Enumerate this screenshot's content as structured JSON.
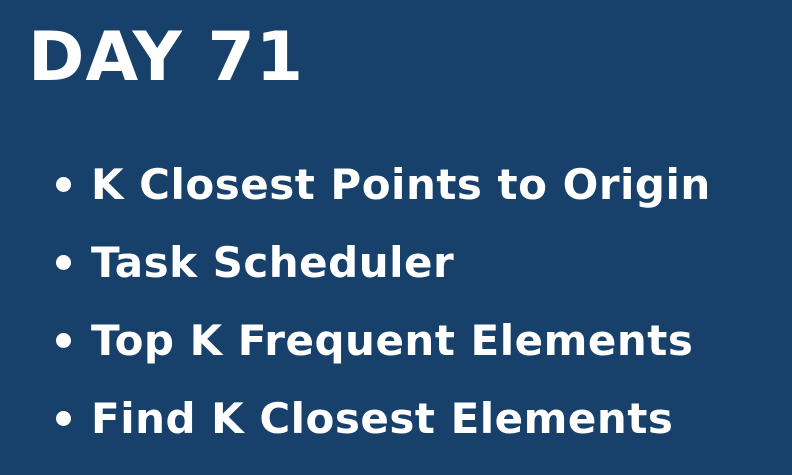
{
  "slide": {
    "title": "DAY 71",
    "topics": [
      "K Closest Points to Origin",
      "Task Scheduler",
      "Top K Frequent Elements",
      "Find K Closest Elements"
    ]
  },
  "colors": {
    "background": "#17406b",
    "text": "#ffffff"
  }
}
